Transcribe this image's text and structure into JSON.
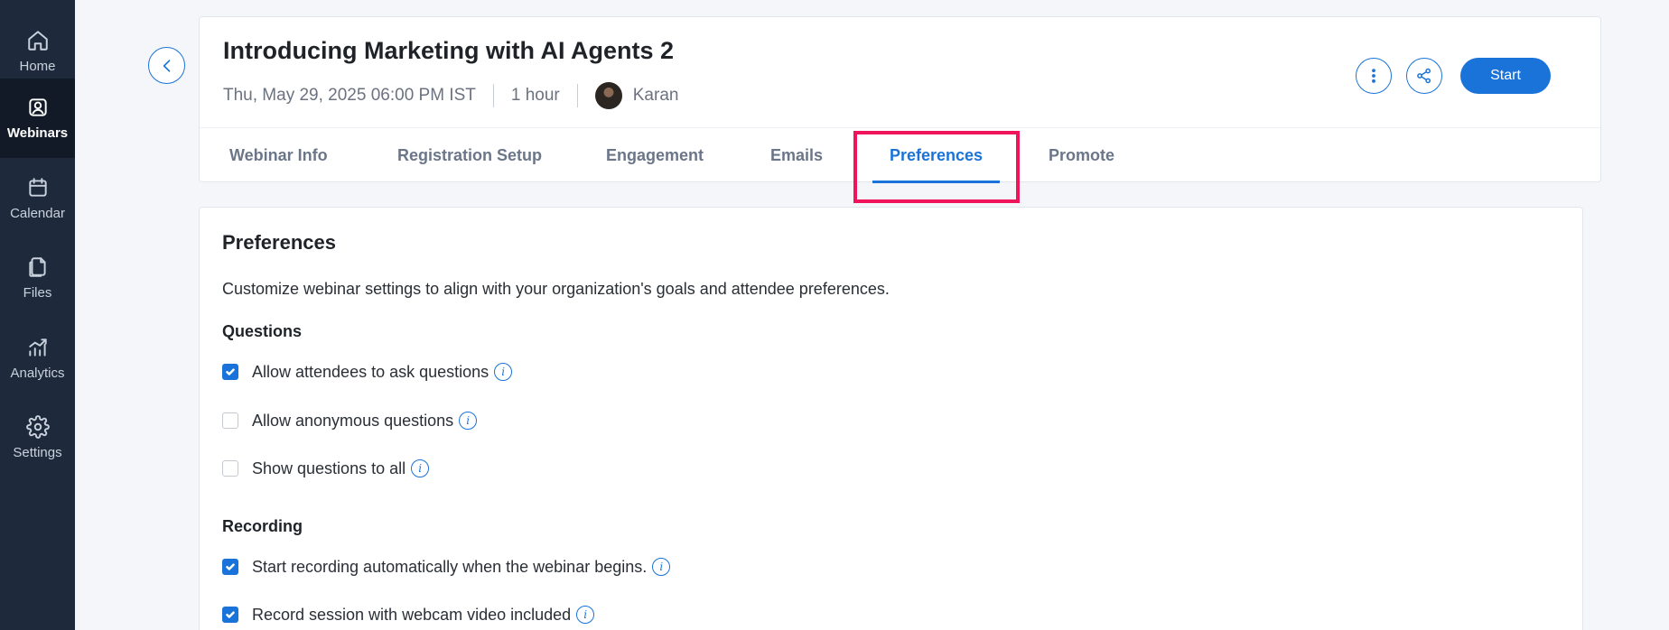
{
  "sidebar": {
    "items": [
      {
        "label": "Home",
        "icon": "home-icon"
      },
      {
        "label": "Webinars",
        "icon": "webinar-icon",
        "active": true
      },
      {
        "label": "Calendar",
        "icon": "calendar-icon"
      },
      {
        "label": "Files",
        "icon": "files-icon"
      },
      {
        "label": "Analytics",
        "icon": "analytics-icon"
      },
      {
        "label": "Settings",
        "icon": "gear-icon"
      }
    ]
  },
  "header": {
    "title": "Introducing Marketing with AI Agents 2",
    "datetime": "Thu, May 29, 2025 06:00 PM IST",
    "duration": "1 hour",
    "host": "Karan",
    "start_label": "Start"
  },
  "tabs": [
    {
      "label": "Webinar Info"
    },
    {
      "label": "Registration Setup"
    },
    {
      "label": "Engagement"
    },
    {
      "label": "Emails"
    },
    {
      "label": "Preferences",
      "active": true
    },
    {
      "label": "Promote"
    }
  ],
  "preferences": {
    "title": "Preferences",
    "description": "Customize webinar settings to align with your organization's goals and attendee preferences.",
    "questions": {
      "label": "Questions",
      "options": [
        {
          "label": "Allow attendees to ask questions",
          "checked": true
        },
        {
          "label": "Allow anonymous questions",
          "checked": false
        },
        {
          "label": "Show questions to all",
          "checked": false
        }
      ]
    },
    "recording": {
      "label": "Recording",
      "options": [
        {
          "label": "Start recording automatically when the webinar begins.",
          "checked": true
        },
        {
          "label": "Record session with webcam video included",
          "checked": true
        }
      ]
    }
  },
  "colors": {
    "accent": "#1a73d9",
    "sidebar_bg": "#1e2a3b",
    "highlight": "#f0145a"
  }
}
